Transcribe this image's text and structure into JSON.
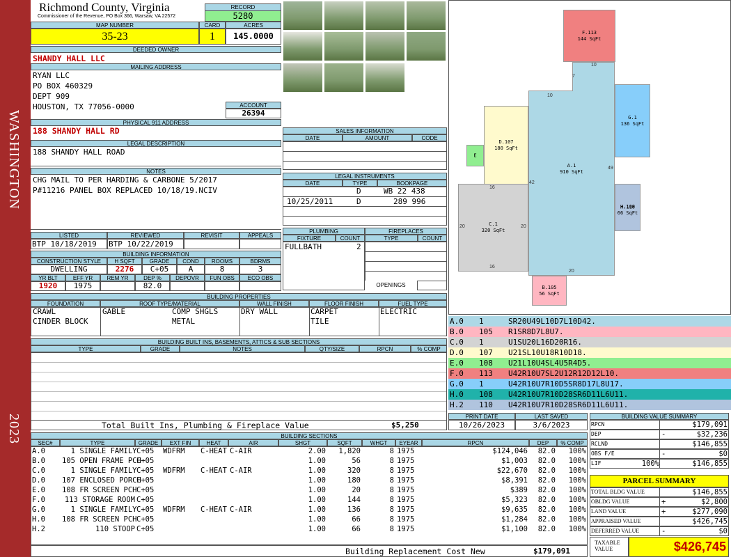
{
  "county": "Richmond County, Virginia",
  "commissioner": "Commissioner of the Revenue, PO Box 366, Warsaw, VA 22572",
  "district": "WASHINGTON",
  "year": "2023",
  "record": {
    "label": "RECORD",
    "value": "5280"
  },
  "map": {
    "label": "MAP NUMBER",
    "value": "35-23"
  },
  "card": {
    "label": "CARD",
    "value": "1"
  },
  "acres": {
    "label": "ACRES",
    "value": "145.0000"
  },
  "owner": {
    "label": "DEEDED OWNER",
    "value": "SHANDY HALL LLC"
  },
  "mailing": {
    "label": "MAILING ADDRESS",
    "lines": [
      "RYAN LLC",
      "PO BOX 460329",
      "DEPT 909",
      "HOUSTON, TX 77056-0000"
    ]
  },
  "account": {
    "label": "ACCOUNT",
    "value": "26394"
  },
  "physical": {
    "label": "PHYSICAL 911 ADDRESS",
    "value": "188 SHANDY HALL RD"
  },
  "legal": {
    "label": "LEGAL DESCRIPTION",
    "value": "188 SHANDY HALL ROAD"
  },
  "notes": {
    "label": "NOTES",
    "lines": [
      "CHG MAIL TO PER HARDING & CARBONE 5/2017",
      "P#11216 PANEL BOX REPLACED 10/18/19.NCIV"
    ]
  },
  "review": {
    "headers": [
      "LISTED",
      "REVIEWED",
      "REVISIT",
      "APPEALS"
    ],
    "listed": "BTP 10/18/2019",
    "reviewed": "BTP 10/22/2019",
    "revisit": "",
    "appeals": ""
  },
  "building_info": {
    "label": "BUILDING INFORMATION",
    "headers": [
      "CONSTRUCTION STYLE",
      "H SQFT",
      "GRADE",
      "COND",
      "ROOMS",
      "BDRMS"
    ],
    "values": [
      "DWELLING",
      "2276",
      "C+05",
      "A",
      "8",
      "3"
    ],
    "headers2": [
      "YR BLT",
      "EFF YR",
      "REM YR",
      "DEP %",
      "DEPOVR",
      "FUN OBS",
      "ECO OBS"
    ],
    "values2": [
      "1920",
      "1975",
      "",
      "82.0",
      "",
      "",
      ""
    ]
  },
  "sales": {
    "label": "SALES INFORMATION",
    "headers": [
      "DATE",
      "AMOUNT",
      "CODE"
    ]
  },
  "legal_instruments": {
    "label": "LEGAL INSTRUMENTS",
    "headers": [
      "DATE",
      "TYPE",
      "BOOKPAGE"
    ],
    "rows": [
      [
        "",
        "D",
        "WB 22 438"
      ],
      [
        "10/25/2011",
        "D",
        "289 996"
      ]
    ]
  },
  "plumbing": {
    "label": "PLUMBING",
    "headers": [
      "FIXTURE",
      "COUNT"
    ],
    "rows": [
      [
        "FULLBATH",
        "2"
      ]
    ]
  },
  "fireplaces": {
    "label": "FIREPLACES",
    "headers": [
      "TYPE",
      "COUNT"
    ],
    "openings": "OPENINGS"
  },
  "properties": {
    "label": "BUILDING PROPERTIES",
    "headers": [
      "FOUNDATION",
      "ROOF TYPE/MATERIAL",
      "WALL FINISH",
      "FLOOR FINISH",
      "FUEL TYPE"
    ],
    "foundation": [
      "CRAWL",
      "CINDER BLOCK"
    ],
    "roof_type": [
      "GABLE"
    ],
    "roof_material": [
      "COMP SHGLS",
      "METAL"
    ],
    "wall": [
      "DRY WALL"
    ],
    "floor": [
      "CARPET",
      "TILE"
    ],
    "fuel": [
      "ELECTRIC"
    ]
  },
  "builtins": {
    "label": "BUILDING BUILT INS, BASEMENTS, ATTICS & SUB SECTIONS",
    "headers": [
      "TYPE",
      "GRADE",
      "NOTES",
      "QTY/SIZE",
      "RPCN",
      "% COMP"
    ],
    "total_label": "Total Built Ins, Plumbing & Fireplace Value",
    "total_value": "$5,250"
  },
  "sketch_legend": [
    {
      "id": "A.0",
      "code": "1",
      "path": "SR20U49L10D7L10D42.",
      "color": "#add8e6"
    },
    {
      "id": "B.0",
      "code": "105",
      "path": "R1SR8D7L8U7.",
      "color": "#ffb6c1"
    },
    {
      "id": "C.0",
      "code": "1",
      "path": "U1SU20L16D20R16.",
      "color": "#d3d3d3"
    },
    {
      "id": "D.0",
      "code": "107",
      "path": "U21SL10U18R10D18.",
      "color": "#fffacd"
    },
    {
      "id": "E.0",
      "code": "108",
      "path": "U21L10U4SL4U5R4D5.",
      "color": "#90ee90"
    },
    {
      "id": "F.0",
      "code": "113",
      "path": "U42R10U7SL2U12R12D12L10.",
      "color": "#f08080"
    },
    {
      "id": "G.0",
      "code": "1",
      "path": "U42R10U7R10D5SR8D17L8U17.",
      "color": "#87cefa"
    },
    {
      "id": "H.0",
      "code": "108",
      "path": "U42R10U7R10D28SR6D11L6U11.",
      "color": "#20b2aa"
    },
    {
      "id": "H.2",
      "code": "110",
      "path": "U42R10U7R10D28SR6D11L6U11.",
      "color": "#b0c4de"
    }
  ],
  "sketch": {
    "shapes": [
      {
        "id": "F.113",
        "label": "F.113",
        "area": "144 SqFt"
      },
      {
        "id": "G.1",
        "label": "G.1",
        "area": "136 SqFt"
      },
      {
        "id": "D.107",
        "label": "D.107",
        "area": "180 SqFt"
      },
      {
        "id": "E",
        "label": "E",
        "area": ""
      },
      {
        "id": "A.1",
        "label": "A.1",
        "area": "910 SqFt"
      },
      {
        "id": "H.110",
        "label": "H.110",
        "area": ""
      },
      {
        "id": "H.108",
        "label": "H.108",
        "area": "66 SqFt"
      },
      {
        "id": "C.1",
        "label": "C.1",
        "area": "320 SqFt"
      },
      {
        "id": "B.105",
        "label": "B.105",
        "area": "56 SqFt"
      }
    ],
    "dims": [
      "10",
      "7",
      "10",
      "49",
      "42",
      "16",
      "20",
      "20",
      "16",
      "20"
    ]
  },
  "print": {
    "headers": [
      "PRINT DATE",
      "LAST SAVED"
    ],
    "print_date": "10/26/2023",
    "last_saved": "3/6/2023"
  },
  "sections": {
    "label": "BUILDING SECTIONS",
    "headers": [
      "SEC#",
      "TYPE",
      "GRADE",
      "EXT FIN",
      "HEAT",
      "AIR",
      "SHGT",
      "SQFT",
      "WHGT",
      "EYEAR",
      "RPCN",
      "DEP",
      "% COMP"
    ],
    "rows": [
      [
        "A.0",
        "1 SINGLE FAMILY",
        "C+05",
        "WDFRM",
        "C-HEAT",
        "C-AIR",
        "2.00",
        "1,820",
        "8",
        "1975",
        "$124,046",
        "82.0",
        "100%"
      ],
      [
        "B.0",
        "105 OPEN FRAME PCH",
        "C+05",
        "",
        "",
        "",
        "1.00",
        "56",
        "8",
        "1975",
        "$1,003",
        "82.0",
        "100%"
      ],
      [
        "C.0",
        "1 SINGLE FAMILY",
        "C+05",
        "WDFRM",
        "C-HEAT",
        "C-AIR",
        "1.00",
        "320",
        "8",
        "1975",
        "$22,670",
        "82.0",
        "100%"
      ],
      [
        "D.0",
        "107 ENCLOSED PORCH",
        "C+05",
        "",
        "",
        "",
        "1.00",
        "180",
        "8",
        "1975",
        "$8,391",
        "82.0",
        "100%"
      ],
      [
        "E.0",
        "108 FR SCREEN PCH",
        "C+05",
        "",
        "",
        "",
        "1.00",
        "20",
        "8",
        "1975",
        "$389",
        "82.0",
        "100%"
      ],
      [
        "F.0",
        "113 STORAGE ROOM",
        "C+05",
        "",
        "",
        "",
        "1.00",
        "144",
        "8",
        "1975",
        "$5,323",
        "82.0",
        "100%"
      ],
      [
        "G.0",
        "1 SINGLE FAMILY",
        "C+05",
        "WDFRM",
        "C-HEAT",
        "C-AIR",
        "1.00",
        "136",
        "8",
        "1975",
        "$9,635",
        "82.0",
        "100%"
      ],
      [
        "H.0",
        "108 FR SCREEN PCH",
        "C+05",
        "",
        "",
        "",
        "1.00",
        "66",
        "8",
        "1975",
        "$1,284",
        "82.0",
        "100%"
      ],
      [
        "H.2",
        "110 STOOP",
        "C+05",
        "",
        "",
        "",
        "1.00",
        "66",
        "8",
        "1975",
        "$1,100",
        "82.0",
        "100%"
      ]
    ],
    "total_label": "Building Replacement Cost New",
    "total_value": "$179,091"
  },
  "bvs": {
    "label": "BUILDING VALUE SUMMARY",
    "rows": [
      {
        "k": "RPCN",
        "pct": "",
        "op": "",
        "v": "$179,091"
      },
      {
        "k": "DEP",
        "pct": "",
        "op": "-",
        "v": "$32,236"
      },
      {
        "k": "RCLND",
        "pct": "",
        "op": "",
        "v": "$146,855"
      },
      {
        "k": "OBS F/E",
        "pct": "",
        "op": "-",
        "v": "$0"
      },
      {
        "k": "LIF",
        "pct": "100%",
        "op": "",
        "v": "$146,855"
      }
    ]
  },
  "parcel": {
    "label": "PARCEL SUMMARY",
    "rows": [
      {
        "k": "TOTAL BLDG VALUE",
        "op": "",
        "v": "$146,855"
      },
      {
        "k": "OBLDG VALUE",
        "op": "+",
        "v": "$2,800"
      },
      {
        "k": "LAND VALUE",
        "op": "+",
        "v": "$277,090"
      },
      {
        "k": "APPRAISED VALUE",
        "op": "",
        "v": "$426,745"
      },
      {
        "k": "DEFERRED VALUE",
        "op": "-",
        "v": "$0"
      }
    ],
    "taxable_label": "TAXABLE VALUE",
    "taxable_value": "$426,745"
  },
  "photos": [
    "photo-gazebo",
    "photo-outbuilding",
    "photo-house-front",
    "photo-stairs",
    "photo-private-road-sign",
    "photo-house-side",
    "photo-shed-ramp",
    "photo-shed",
    "photo-gazebo-2",
    "photo-house-rear",
    "photo-lamp-post"
  ]
}
